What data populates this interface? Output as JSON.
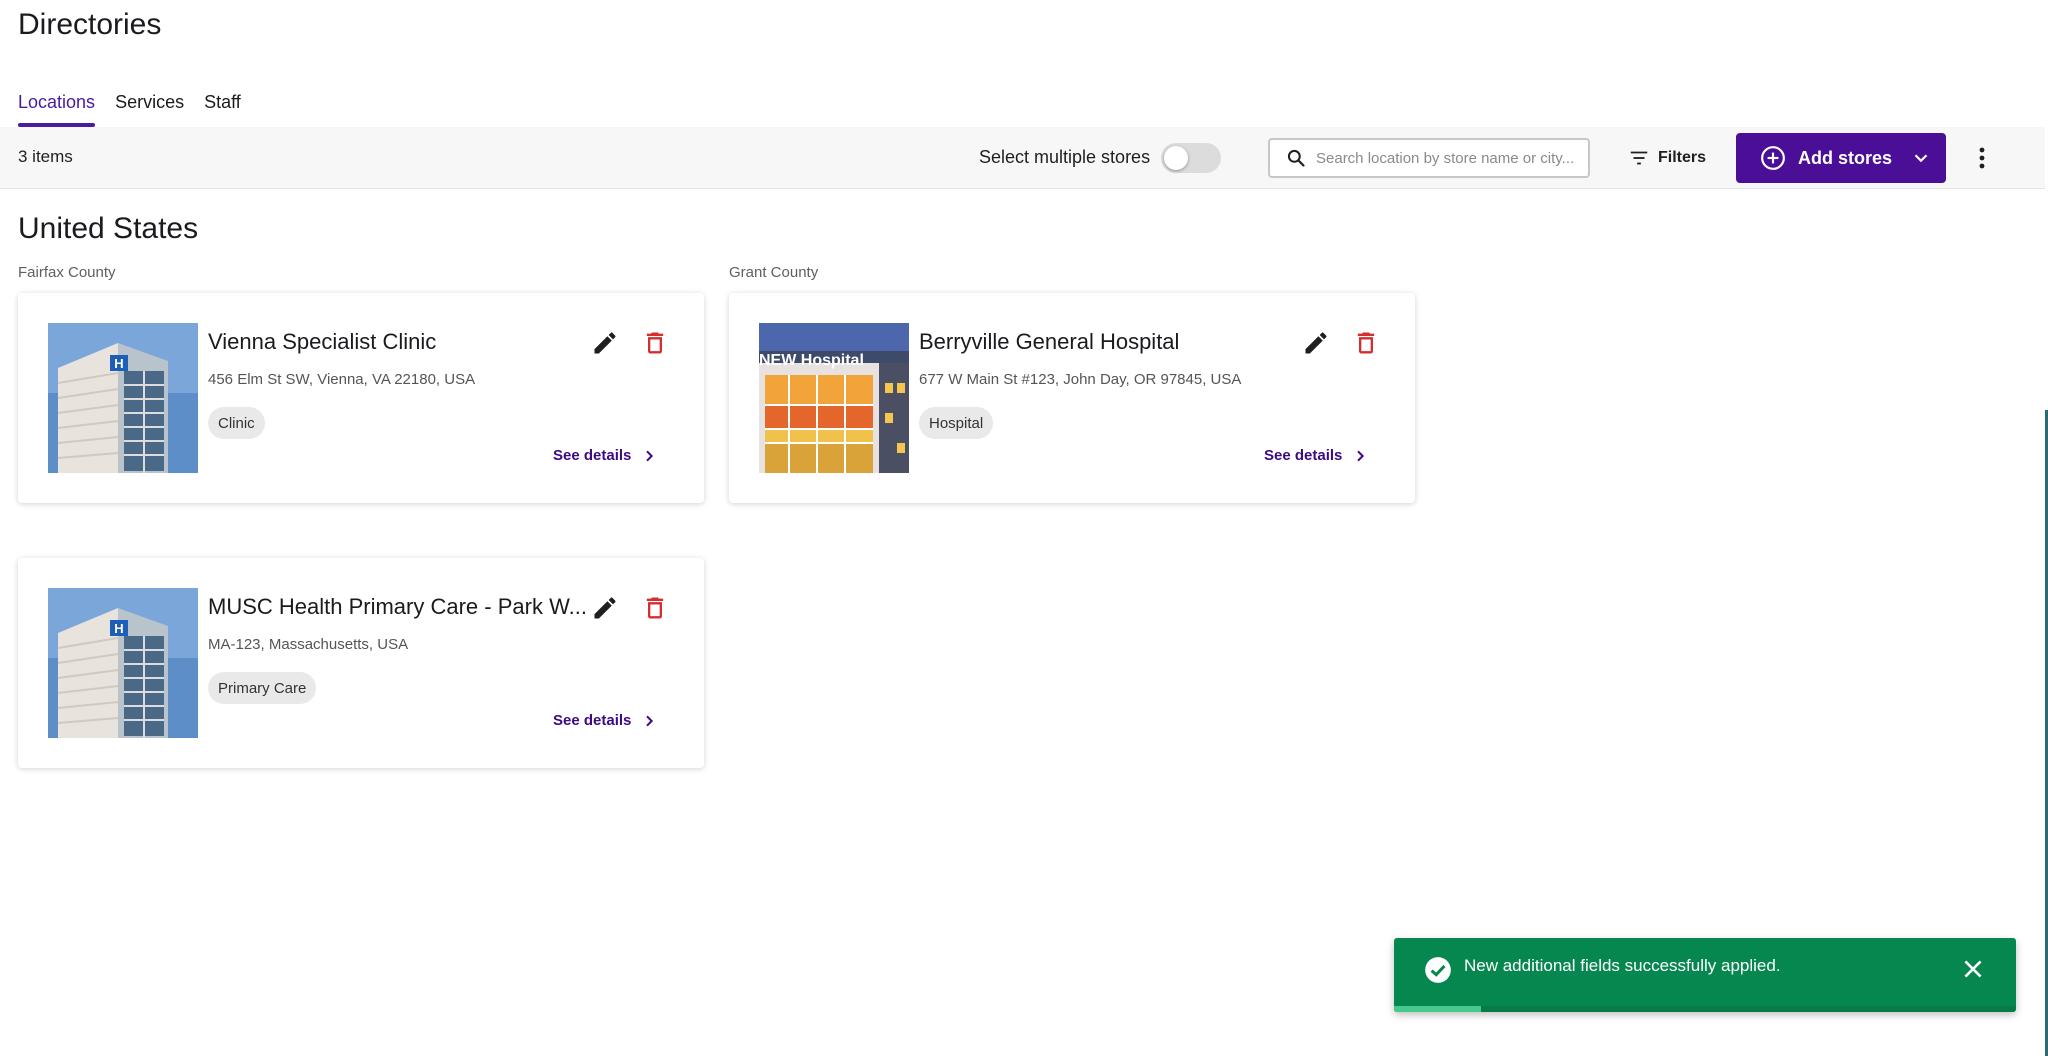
{
  "header": {
    "title": "Directories"
  },
  "tabs": [
    {
      "label": "Locations",
      "active": true
    },
    {
      "label": "Services",
      "active": false
    },
    {
      "label": "Staff",
      "active": false
    }
  ],
  "toolbar": {
    "items_count": "3 items",
    "multi_select_label": "Select multiple stores",
    "multi_select_on": false,
    "search_placeholder": "Search location by store name or city...",
    "filters_label": "Filters",
    "add_label": "Add stores"
  },
  "section": {
    "country": "United States",
    "groups": [
      {
        "county": "Fairfax County"
      },
      {
        "county": "Grant County"
      }
    ]
  },
  "cards": [
    {
      "title": "Vienna Specialist Clinic",
      "address": "456 Elm St SW, Vienna, VA 22180, USA",
      "tag": "Clinic",
      "image": "hospital-tower-image",
      "see_details": "See details"
    },
    {
      "title": "Berryville General Hospital",
      "address": "677 W Main St #123, John Day, OR 97845, USA",
      "tag": "Hospital",
      "image": "new-hospital-building-image",
      "image_text": "NEW Hospital",
      "see_details": "See details"
    },
    {
      "title": "MUSC Health Primary Care - Park W...",
      "address": "MA-123, Massachusetts, USA",
      "tag": "Primary Care",
      "image": "hospital-tower-image",
      "see_details": "See details"
    }
  ],
  "toast": {
    "message": "New additional fields successfully applied.",
    "progress": 0.14
  },
  "colors": {
    "primary": "#4a0f96",
    "tab_active": "#4a1a9f",
    "link": "#3d0a80",
    "delete": "#d32f2f",
    "toast_bg": "#06874f",
    "toast_progress": "#46c98a"
  },
  "icons": {
    "search": "search-icon",
    "filters": "filter-icon",
    "add": "add-circle-icon",
    "dropdown": "chevron-down-icon",
    "more": "more-vertical-icon",
    "edit": "pencil-icon",
    "delete": "trash-icon",
    "details": "chevron-right-icon",
    "success": "check-circle-icon",
    "close": "close-icon"
  }
}
